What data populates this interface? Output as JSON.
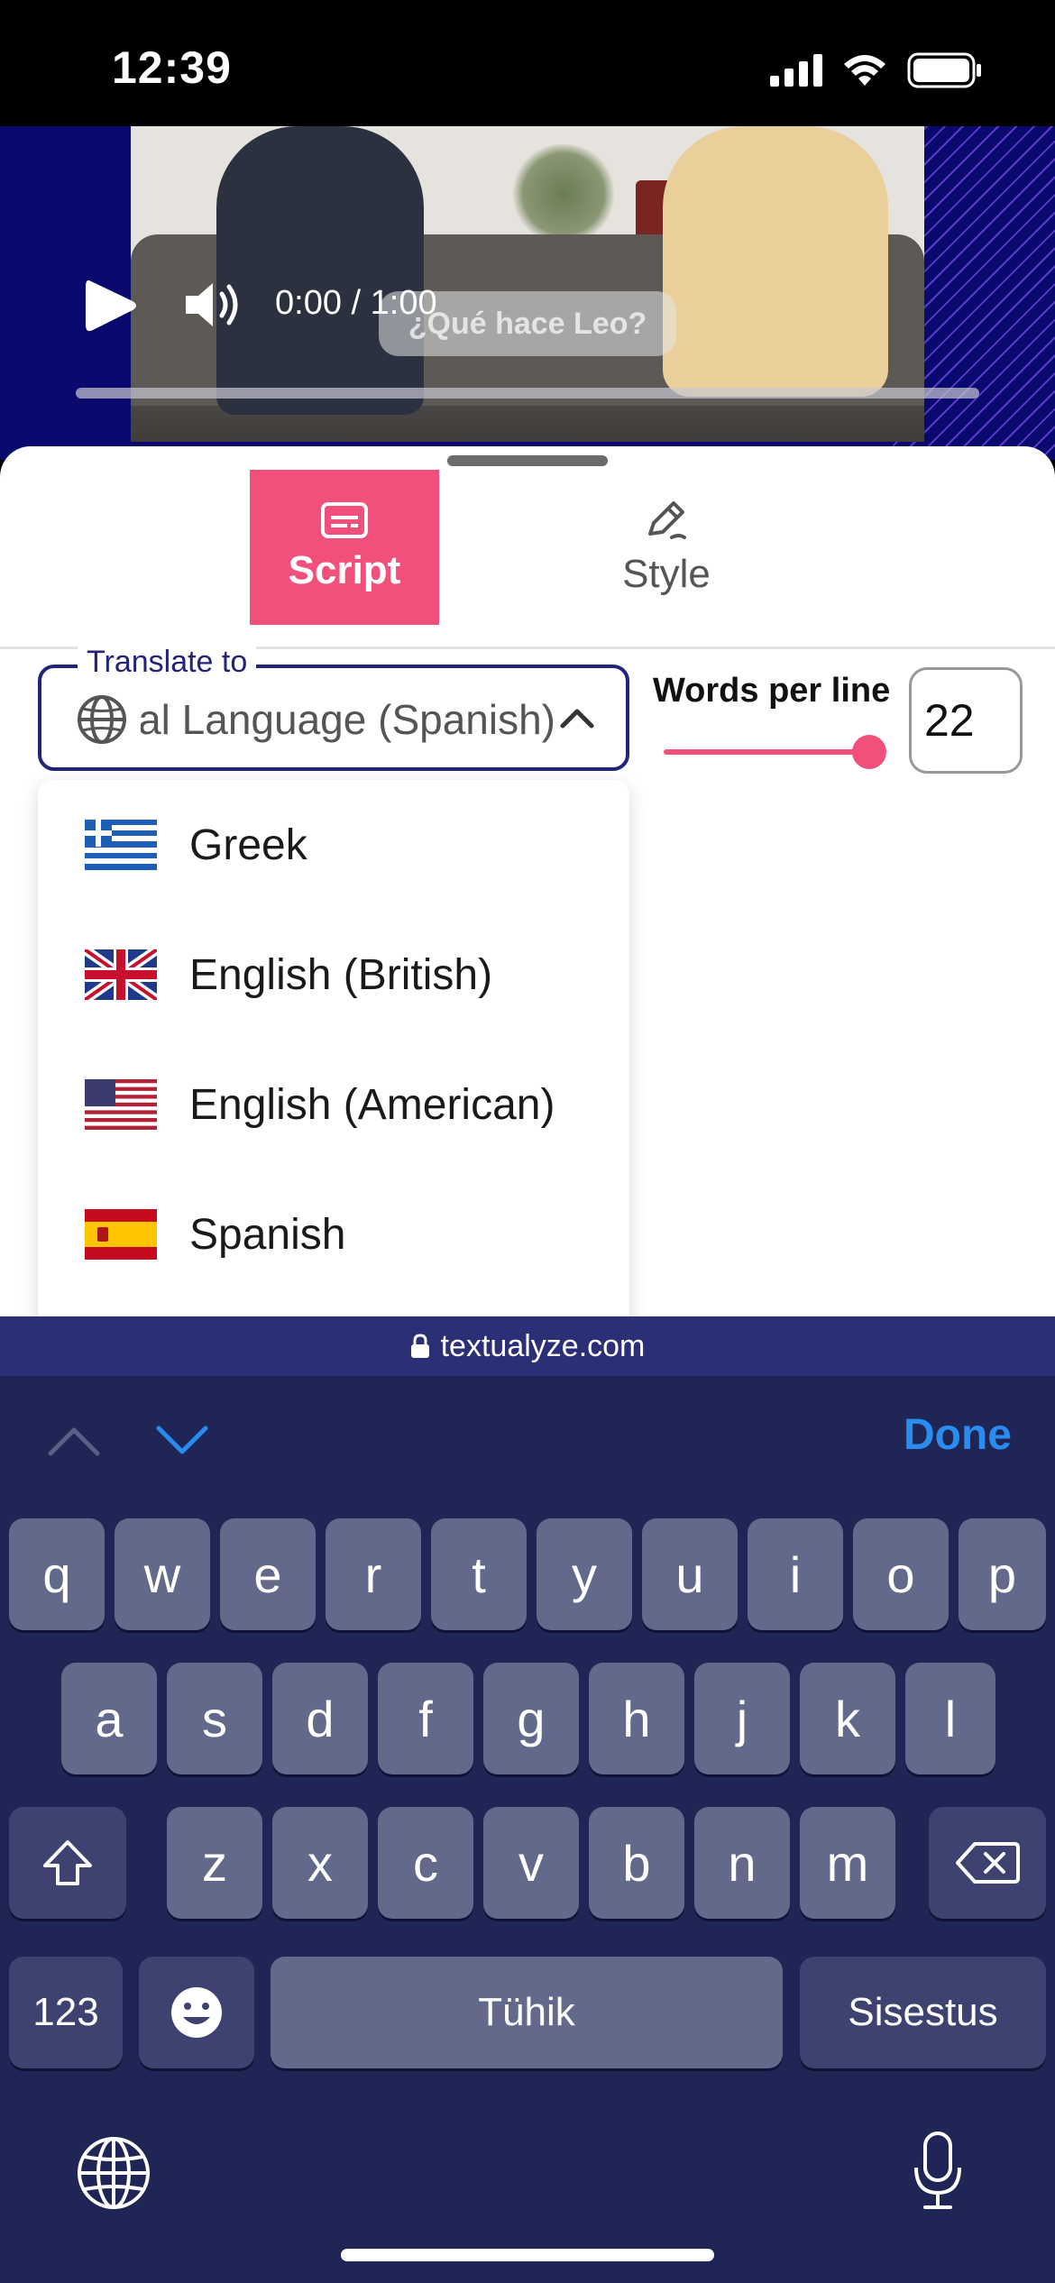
{
  "status_bar": {
    "time": "12:39"
  },
  "video": {
    "time_readout": "0:00 / 1:00",
    "caption": "¿Qué hace Leo?"
  },
  "tabs": [
    {
      "label": "Script",
      "icon": "subtitles-icon",
      "active": true
    },
    {
      "label": "Style",
      "icon": "pen-icon",
      "active": false
    }
  ],
  "translate": {
    "legend": "Translate to",
    "value": "Original Language (Spanish)"
  },
  "words_per_line": {
    "label": "Words per line",
    "value": "22",
    "slider_fraction": 0.95
  },
  "dropdown": {
    "options": [
      {
        "label": "Greek",
        "flag": "greece-flag"
      },
      {
        "label": "English (British)",
        "flag": "uk-flag"
      },
      {
        "label": "English (American)",
        "flag": "us-flag"
      },
      {
        "label": "Spanish",
        "flag": "spain-flag"
      }
    ]
  },
  "url_bar": {
    "domain": "textualyze.com"
  },
  "keyboard": {
    "done_label": "Done",
    "row1": [
      "q",
      "w",
      "e",
      "r",
      "t",
      "y",
      "u",
      "i",
      "o",
      "p"
    ],
    "row2": [
      "a",
      "s",
      "d",
      "f",
      "g",
      "h",
      "j",
      "k",
      "l"
    ],
    "row3": [
      "z",
      "x",
      "c",
      "v",
      "b",
      "n",
      "m"
    ],
    "numbers_label": "123",
    "space_label": "Tühik",
    "return_label": "Sisestus"
  },
  "colors": {
    "accent": "#f1507a",
    "navy": "#23237a",
    "keyboard_bg": "#1f2554",
    "done": "#2a8cf0"
  }
}
